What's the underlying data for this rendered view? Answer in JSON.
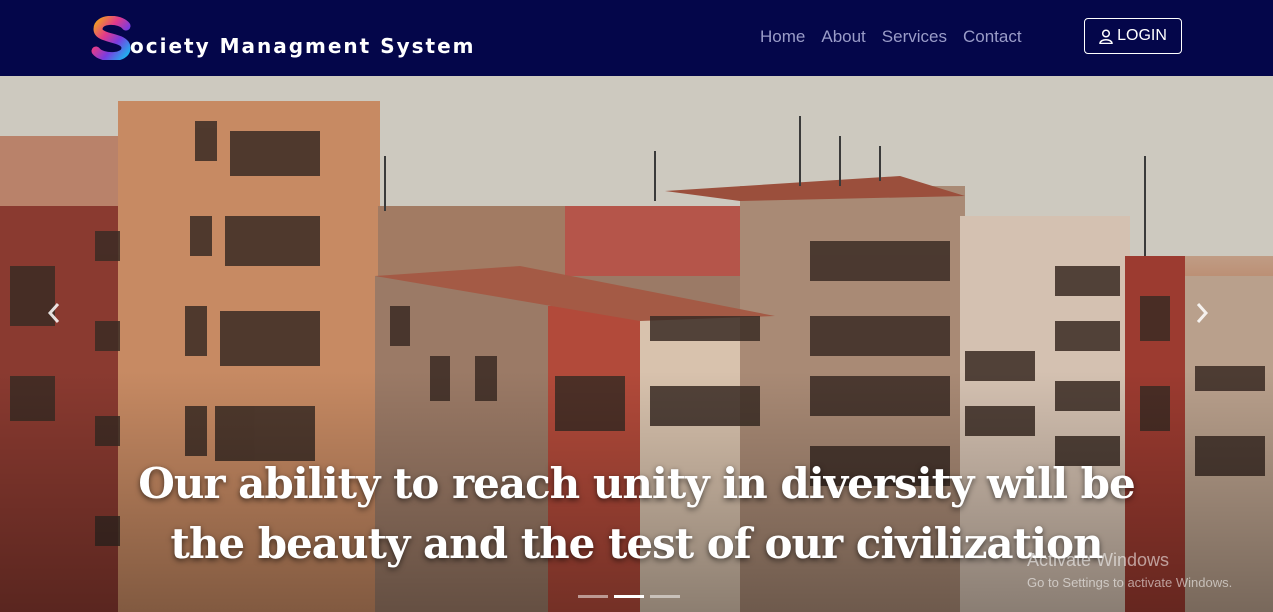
{
  "brand": {
    "logo_letter": "S",
    "name": "ociety Managment System"
  },
  "nav": {
    "links": [
      "Home",
      "About",
      "Services",
      "Contact"
    ],
    "login_label": "LOGIN"
  },
  "hero": {
    "caption_line1": "Our ability to reach unity in diversity will be",
    "caption_line2": "the beauty and the test of our civilization",
    "slides": 3,
    "active_slide": 2
  },
  "watermark": {
    "line1": "Activate Windows",
    "line2": "Go to Settings to activate Windows."
  },
  "colors": {
    "navbar": "#04064a",
    "nav_link": "#9a9cc8",
    "text": "#ffffff"
  },
  "icons": {
    "login": "user-icon",
    "prev": "chevron-left-icon",
    "next": "chevron-right-icon"
  }
}
